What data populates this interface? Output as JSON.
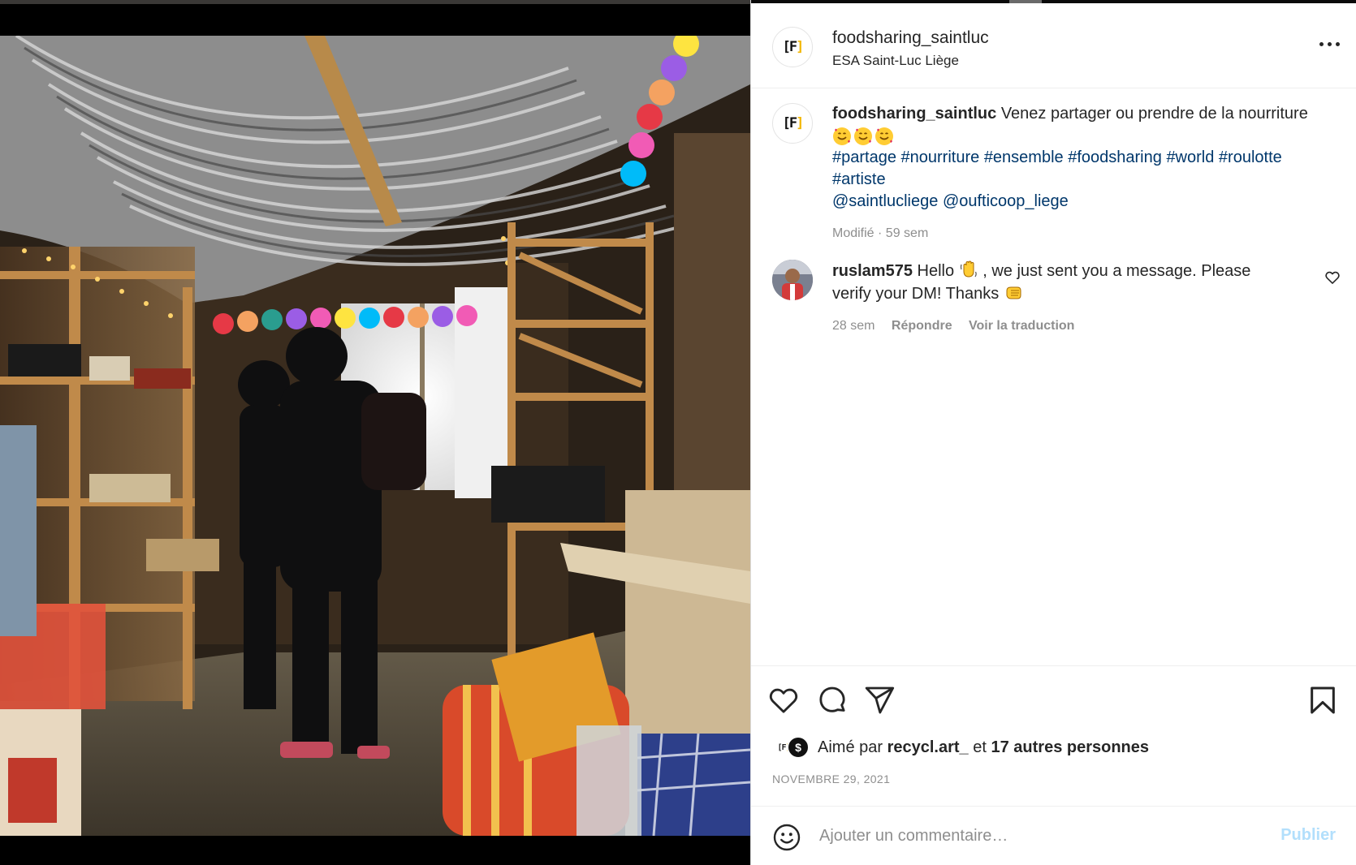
{
  "post": {
    "username": "foodsharing_saintluc",
    "location": "ESA Saint-Luc Liège",
    "avatar_letter": "F"
  },
  "caption": {
    "username": "foodsharing_saintluc",
    "text": "Venez partager ou prendre de la nourriture",
    "emojis": [
      "smiling-face-with-hearts",
      "smiling-face-with-hearts",
      "smiling-face-with-hearts"
    ],
    "hashtags": [
      "#partage",
      "#nourriture",
      "#ensemble",
      "#foodsharing",
      "#world",
      "#roulotte",
      "#artiste"
    ],
    "mentions": [
      "@saintlucliege",
      "@oufticoop_liege"
    ],
    "meta": "Modifié · 59 sem"
  },
  "comment": {
    "username": "ruslam575",
    "text_before": "Hello",
    "text_after": ", we just sent you a message. Please verify your DM! Thanks",
    "emoji_1": "waving-hand",
    "emoji_2": "left-facing-fist",
    "time": "28 sem",
    "reply_label": "Répondre",
    "translate_label": "Voir la traduction"
  },
  "actions": {
    "icons": [
      "heart-icon",
      "comment-icon",
      "share-icon",
      "bookmark-icon"
    ],
    "liked_by_prefix": "Aimé par",
    "liked_by_user": "recycl.art_",
    "liked_by_and": "et",
    "liked_by_others": "17 autres personnes",
    "date": "NOVEMBRE 29, 2021"
  },
  "comment_bar": {
    "placeholder": "Ajouter un commentaire…",
    "publish_label": "Publier"
  },
  "colors": {
    "link": "#00376b",
    "muted": "#8e8e8e",
    "publish_disabled": "#b2dffc",
    "brand_yellow": "#f2b705"
  }
}
